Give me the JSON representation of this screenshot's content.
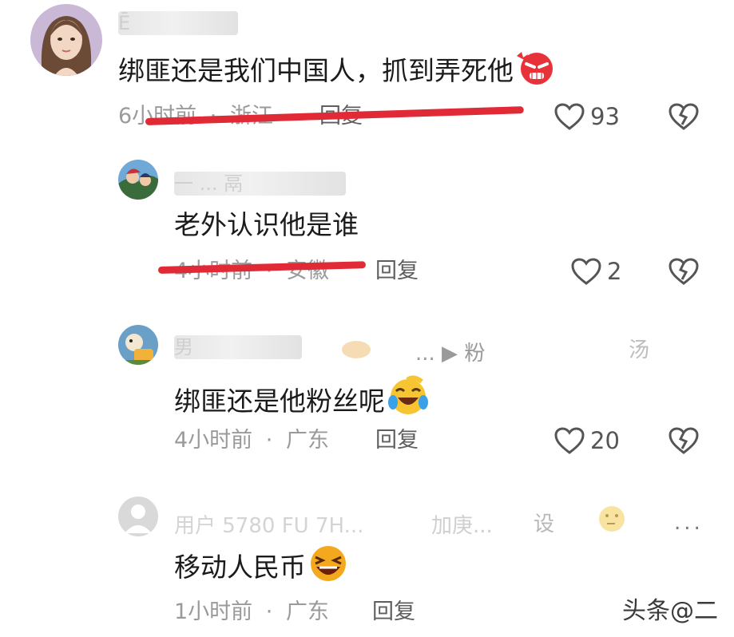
{
  "comments": [
    {
      "username_fragment": "Ē",
      "text": "绑匪还是我们中国人，抓到弄死他",
      "emoji": "angry-face",
      "time": "6小时前",
      "location": "浙江",
      "reply_label": "回复",
      "likes": "93"
    },
    {
      "username_fragment": "一 ... 鬲",
      "text": "老外认识他是谁",
      "time": "4小时前",
      "location": "安徽",
      "reply_label": "回复",
      "likes": "2"
    },
    {
      "username_fragment": "男",
      "username_extra": "... ▶ 粉",
      "username_tail": "汤",
      "text": "绑匪还是他粉丝呢",
      "emoji": "laugh-cry-face",
      "time": "4小时前",
      "location": "广东",
      "reply_label": "回复",
      "likes": "20"
    },
    {
      "username_fragment": "用户 5780 FU 7H...",
      "username_extra": "加庚...",
      "username_tail": "设",
      "text": "移动人民币",
      "emoji": "laughing-face",
      "time": "1小时前",
      "location": "广东",
      "reply_label": "回复",
      "more_label": "..."
    }
  ],
  "meta_separator": "·",
  "watermark": "头条@二",
  "colors": {
    "strike": "#e02a35",
    "meta": "#9a9a9a",
    "reply": "#5e5e5e",
    "text": "#1b1b1b"
  }
}
